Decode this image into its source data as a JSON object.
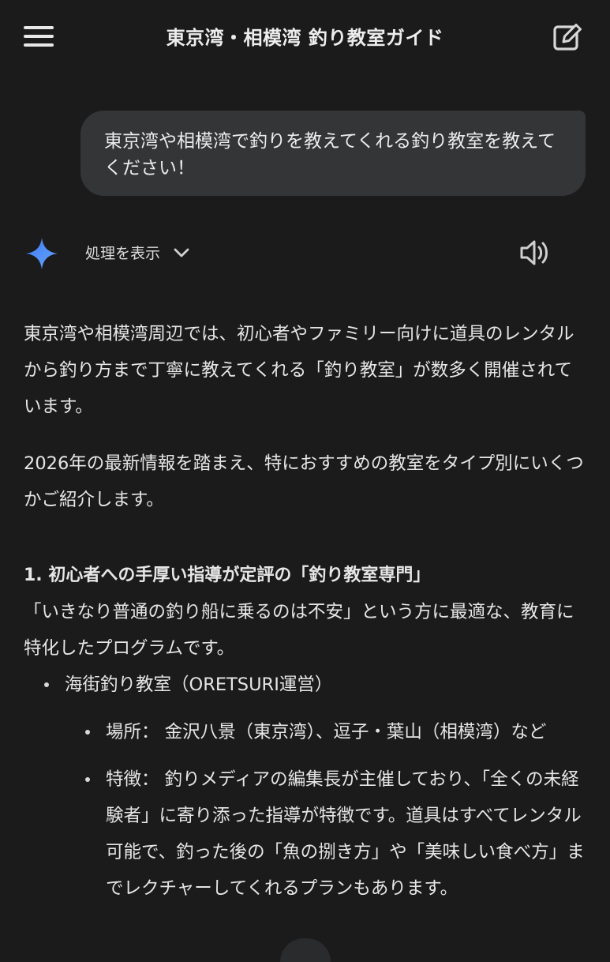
{
  "header": {
    "title": "東京湾・相模湾 釣り教室ガイド",
    "menu_icon": "hamburger-menu-icon",
    "edit_icon": "edit-note-icon"
  },
  "user_message": "東京湾や相模湾で釣りを教えてくれる釣り教室を教えてください！",
  "assistant_header": {
    "show_thinking": "処理を表示",
    "logo_icon": "gemini-sparkle-icon",
    "speaker_icon": "speaker-icon"
  },
  "response": {
    "intro": "東京湾や相模湾周辺では、初心者やファミリー向けに道具のレンタルから釣り方まで丁寧に教えてくれる「釣り教室」が数多く開催されています。",
    "note": "2026年の最新情報を踏まえ、特におすすめの教室をタイプ別にいくつかご紹介します。",
    "section1": {
      "heading": "1. 初心者への手厚い指導が定評の「釣り教室専門」",
      "description": "「いきなり普通の釣り船に乗るのは不安」という方に最適な、教育に特化したプログラムです。",
      "items": [
        {
          "name": "海街釣り教室（ORETSURI運営）",
          "details": [
            "場所： 金沢八景（東京湾）、逗子・葉山（相模湾）など",
            "特徴： 釣りメディアの編集長が主催しており、「全くの未経験者」に寄り添った指導が特徴です。道具はすべてレンタル可能で、釣った後の「魚の捌き方」や「美味しい食べ方」までレクチャーしてくれるプランもあります。"
          ]
        }
      ]
    }
  },
  "colors": {
    "background": "#1b1b1c",
    "bubble": "#333537",
    "text": "#e6e6e6",
    "accent_blue": "#4f8df6"
  }
}
